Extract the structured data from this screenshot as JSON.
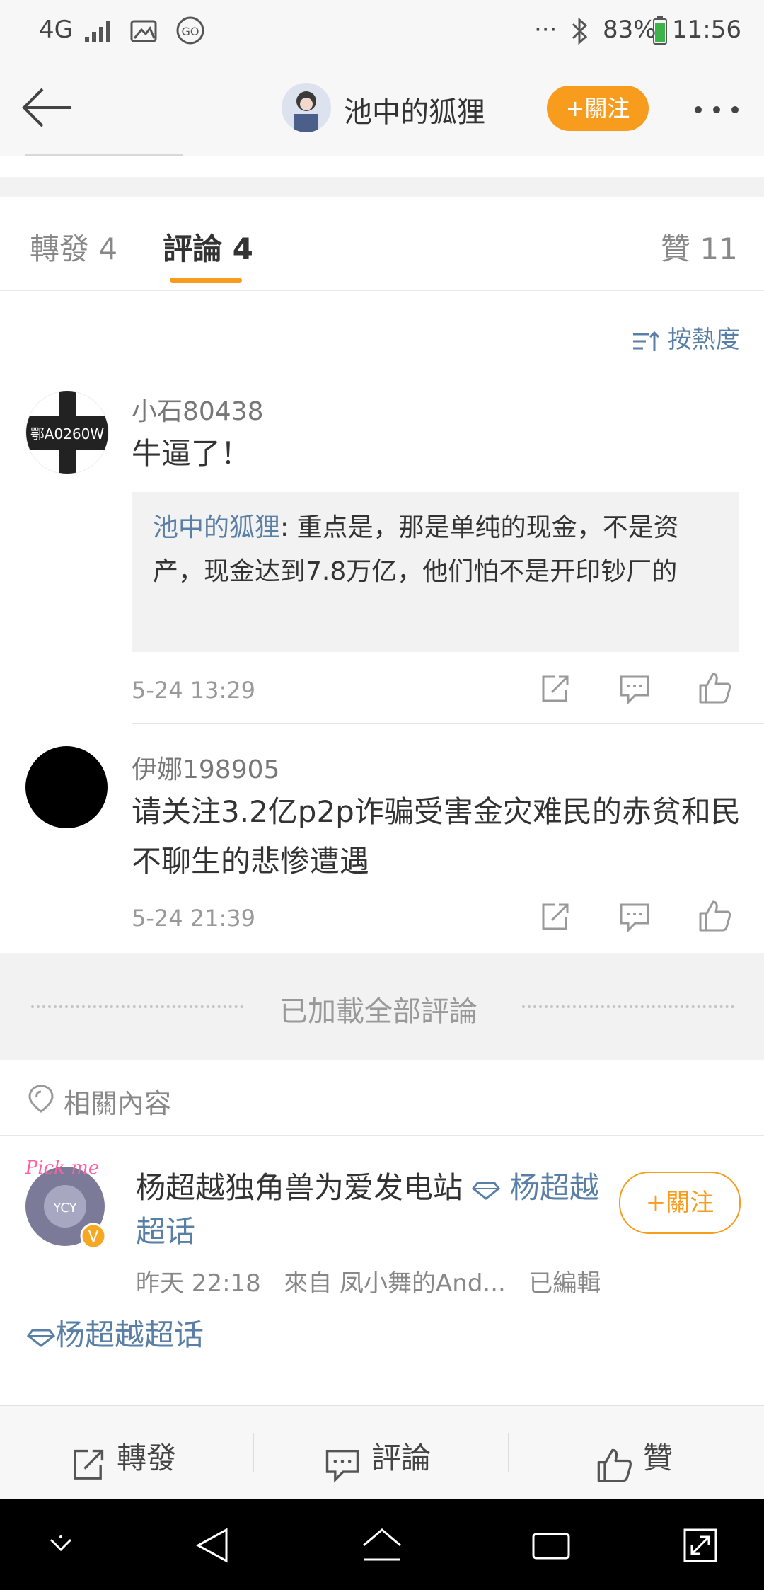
{
  "status_bar": {
    "network": "4G",
    "battery": "83%",
    "time": "11:56",
    "dots": "···"
  },
  "header": {
    "title": "池中的狐狸",
    "follow_label": "+關注"
  },
  "tabs": [
    {
      "label": "轉發 4"
    },
    {
      "label": "評論 4"
    },
    {
      "label": "贊 11"
    }
  ],
  "sort_label": "按熱度",
  "comments": [
    {
      "username": "小石80438",
      "avatar_text": "鄂A0260W",
      "text": "牛逼了！",
      "quote_author": "池中的狐狸",
      "quote_text": ": 重点是，那是单纯的现金，不是资产，现金达到7.8万亿，他们怕不是开印钞厂的",
      "timestamp": "5-24 13:29"
    },
    {
      "username": "伊娜198905",
      "text": "请关注3.2亿p2p诈骗受害金灾难民的赤贫和民不聊生的悲惨遭遇",
      "timestamp": "5-24 21:39"
    }
  ],
  "loaded_all": "已加載全部評論",
  "related": {
    "section_title": "相關內容",
    "post_author": "杨超越独角兽为爱发电站",
    "post_topic": "杨超越超话",
    "follow_label": "+關注",
    "meta_time": "昨天 22:18",
    "meta_source": "來自 凤小舞的And...",
    "meta_edited": "已編輯",
    "topic_link": "杨超越超话"
  },
  "toolbar": {
    "repost": "轉發",
    "comment": "評論",
    "like": "贊"
  },
  "colors": {
    "accent": "#f79c1d",
    "link": "#5a7fa6"
  }
}
